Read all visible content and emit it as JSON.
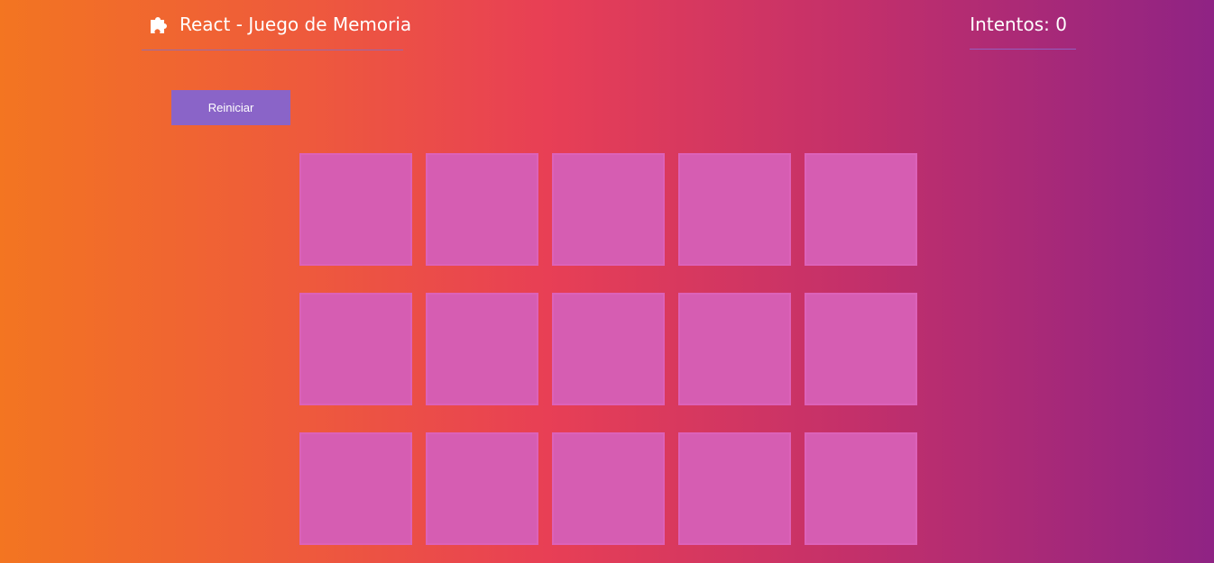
{
  "header": {
    "title": "React - Juego de Memoria",
    "icon": "puzzle-piece-icon",
    "attempts": "Intentos: 0"
  },
  "controls": {
    "reset_label": "Reiniciar"
  },
  "board": {
    "rows": 3,
    "columns": 5,
    "cards": [
      {
        "face": "down"
      },
      {
        "face": "down"
      },
      {
        "face": "down"
      },
      {
        "face": "down"
      },
      {
        "face": "down"
      },
      {
        "face": "down"
      },
      {
        "face": "down"
      },
      {
        "face": "down"
      },
      {
        "face": "down"
      },
      {
        "face": "down"
      },
      {
        "face": "down"
      },
      {
        "face": "down"
      },
      {
        "face": "down"
      },
      {
        "face": "down"
      },
      {
        "face": "down"
      }
    ]
  },
  "colors": {
    "gradient_start": "#f37521",
    "gradient_end": "#8f2384",
    "card_back": "#d65db2",
    "button": "#8a64c8"
  }
}
